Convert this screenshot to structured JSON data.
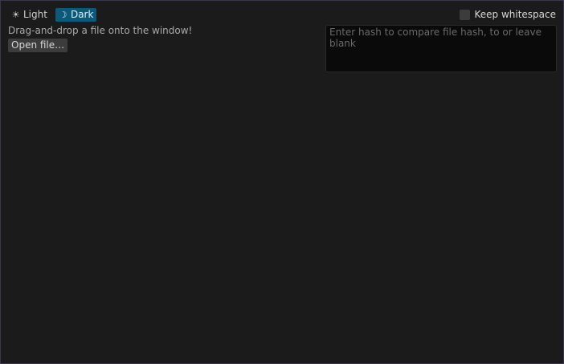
{
  "theme": {
    "light": {
      "label": "Light",
      "icon": "sun-icon",
      "glyph": "☀"
    },
    "dark": {
      "label": "Dark",
      "icon": "moon-icon",
      "glyph": "☽"
    },
    "selected": "dark"
  },
  "main": {
    "hint": "Drag-and-drop a file onto the window!",
    "open_label": "Open file…"
  },
  "options": {
    "keep_whitespace_label": "Keep whitespace",
    "keep_whitespace_checked": false
  },
  "hash": {
    "value": "",
    "placeholder": "Enter hash to compare file hash, to or leave blank"
  },
  "colors": {
    "background": "#1b1b1b",
    "accent": "#0b5a7a",
    "button": "#3c3c3c",
    "input_bg": "#0a0a0a"
  }
}
